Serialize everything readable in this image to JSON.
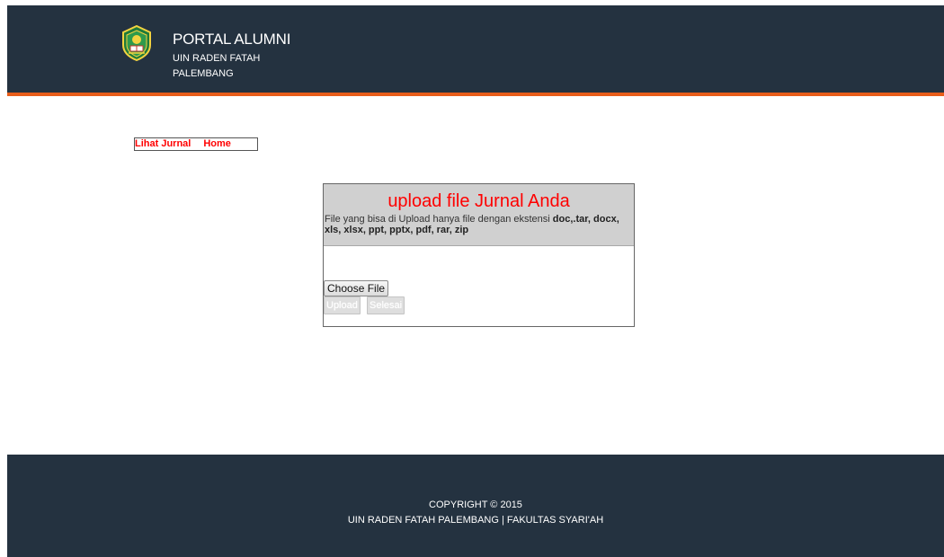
{
  "header": {
    "title": "PORTAL ALUMNI",
    "subtitle": "UIN RADEN FATAH PALEMBANG",
    "logo_icon": "university-emblem-icon",
    "background": "#243240",
    "accent": "#e85d1a"
  },
  "nav": {
    "items": [
      {
        "label": "Lihat Jurnal"
      },
      {
        "label": "Home"
      }
    ],
    "color": "#ff0000"
  },
  "upload": {
    "title": "upload file Jurnal Anda",
    "note_prefix": "File yang bisa di Upload hanya file dengan ekstensi ",
    "note_extensions": "doc,.tar, docx, xls, xlsx, ppt, pptx, pdf, rar, zip",
    "choose_file_label": "Choose File",
    "upload_label": "Upload",
    "finish_label": "Selesai"
  },
  "footer": {
    "copyright": "COPYRIGHT © 2015",
    "institution": "UIN RADEN FATAH PALEMBANG | FAKULTAS SYARI'AH"
  }
}
